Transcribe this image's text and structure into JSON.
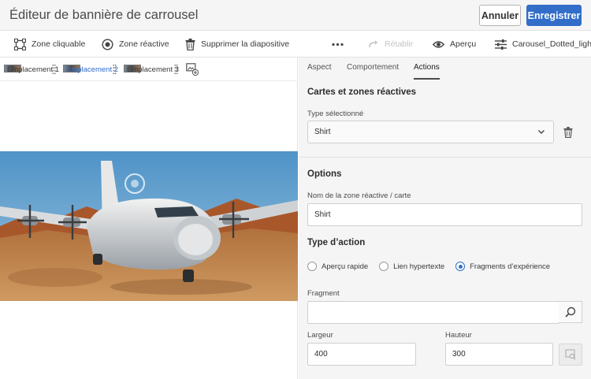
{
  "header": {
    "title": "Éditeur de bannière de carrousel",
    "cancel_label": "Annuler",
    "save_label": "Enregistrer"
  },
  "toolbar": {
    "items": [
      {
        "label": "Zone cliquable",
        "icon": "clickable-zone-icon"
      },
      {
        "label": "Zone réactive",
        "icon": "hotspot-icon"
      },
      {
        "label": "Supprimer la diapositive",
        "icon": "trash-icon"
      },
      {
        "label": "",
        "icon": "more-icon"
      },
      {
        "label": "Rétablir",
        "icon": "redo-icon",
        "disabled": true
      },
      {
        "label": "Aperçu",
        "icon": "eye-icon"
      },
      {
        "label": "Carousel_Dotted_light",
        "icon": "sliders-icon"
      }
    ]
  },
  "slides": [
    {
      "label": "Emplacement 1",
      "active": false
    },
    {
      "label": "Emplacement 2",
      "active": true
    },
    {
      "label": "Emplacement 3",
      "active": false
    }
  ],
  "panel": {
    "tabs": [
      {
        "label": "Aspect",
        "active": false
      },
      {
        "label": "Comportement",
        "active": false
      },
      {
        "label": "Actions",
        "active": true
      }
    ],
    "maps_title": "Cartes et zones réactives",
    "selected_type_label": "Type sélectionné",
    "selected_type_value": "Shirt",
    "options_title": "Options",
    "name_label": "Nom de la zone réactive / carte",
    "name_value": "Shirt",
    "action_type_title": "Type d’action",
    "action_options": [
      {
        "label": "Aperçu rapide",
        "checked": false
      },
      {
        "label": "Lien hypertexte",
        "checked": false
      },
      {
        "label": "Fragments d’expérience",
        "checked": true
      }
    ],
    "fragment_label": "Fragment",
    "fragment_value": "",
    "width_label": "Largeur",
    "width_value": "400",
    "height_label": "Hauteur",
    "height_value": "300"
  },
  "colors": {
    "accent": "#326ec8",
    "header_bg": "#f5f5f5",
    "panel_bg": "#f5f5f5"
  }
}
